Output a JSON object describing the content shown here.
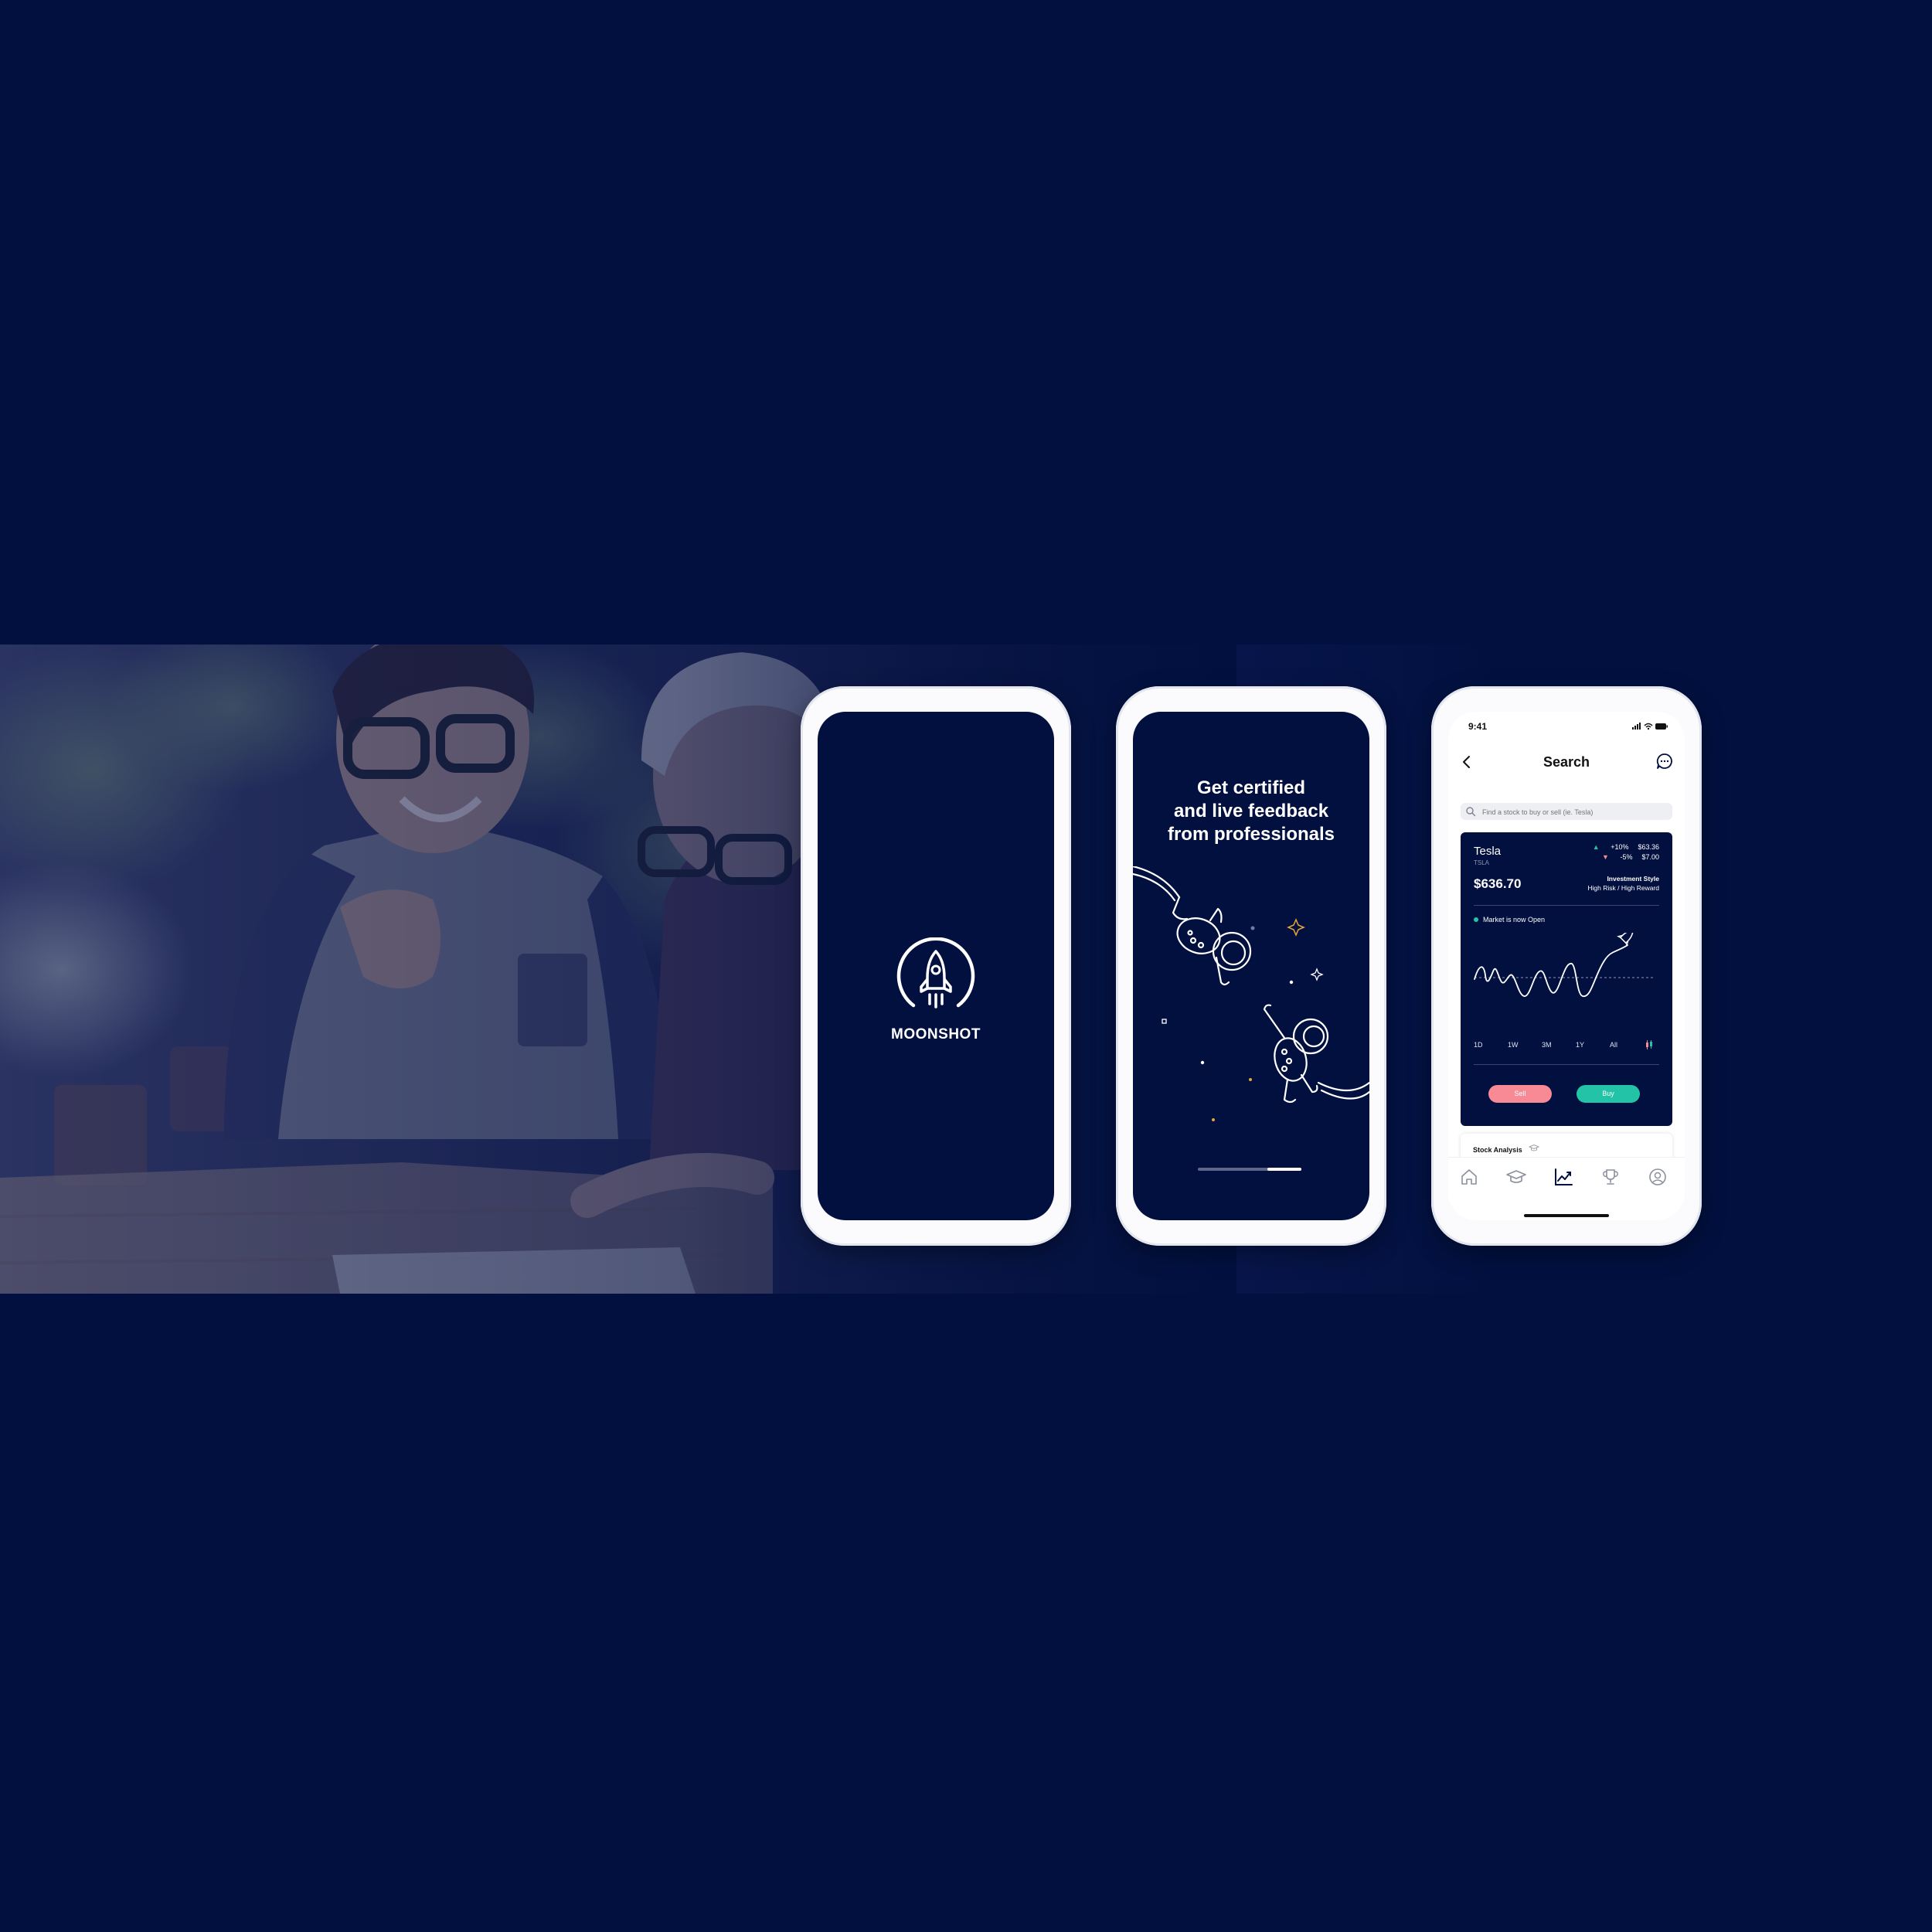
{
  "splash": {
    "brand": "MOONSHOT"
  },
  "onboarding": {
    "title_lines": [
      "Get certified",
      "and live feedback",
      "from professionals"
    ],
    "progress": 0.33
  },
  "app": {
    "status_time": "9:41",
    "header_title": "Search",
    "search_placeholder": "Find a stock to buy or sell (ie. Tesla)",
    "stock": {
      "name": "Tesla",
      "ticker": "TSLA",
      "price": "$636.70",
      "up_pct": "+10%",
      "up_val": "$63.36",
      "down_pct": "-5%",
      "down_val": "$7.00",
      "style_title": "Investment Style",
      "style_value": "High Risk / High Reward",
      "market_status": "Market is now Open"
    },
    "ranges": [
      "1D",
      "1W",
      "3M",
      "1Y",
      "All"
    ],
    "sell_label": "Sell",
    "buy_label": "Buy",
    "analysis_label": "Stock Analysis",
    "tabs": [
      "home-icon",
      "graduation-cap-icon",
      "chart-trend-icon",
      "trophy-icon",
      "profile-icon"
    ]
  },
  "colors": {
    "background": "#01103f",
    "accent_green": "#22c3a6",
    "accent_red": "#f78a94"
  }
}
